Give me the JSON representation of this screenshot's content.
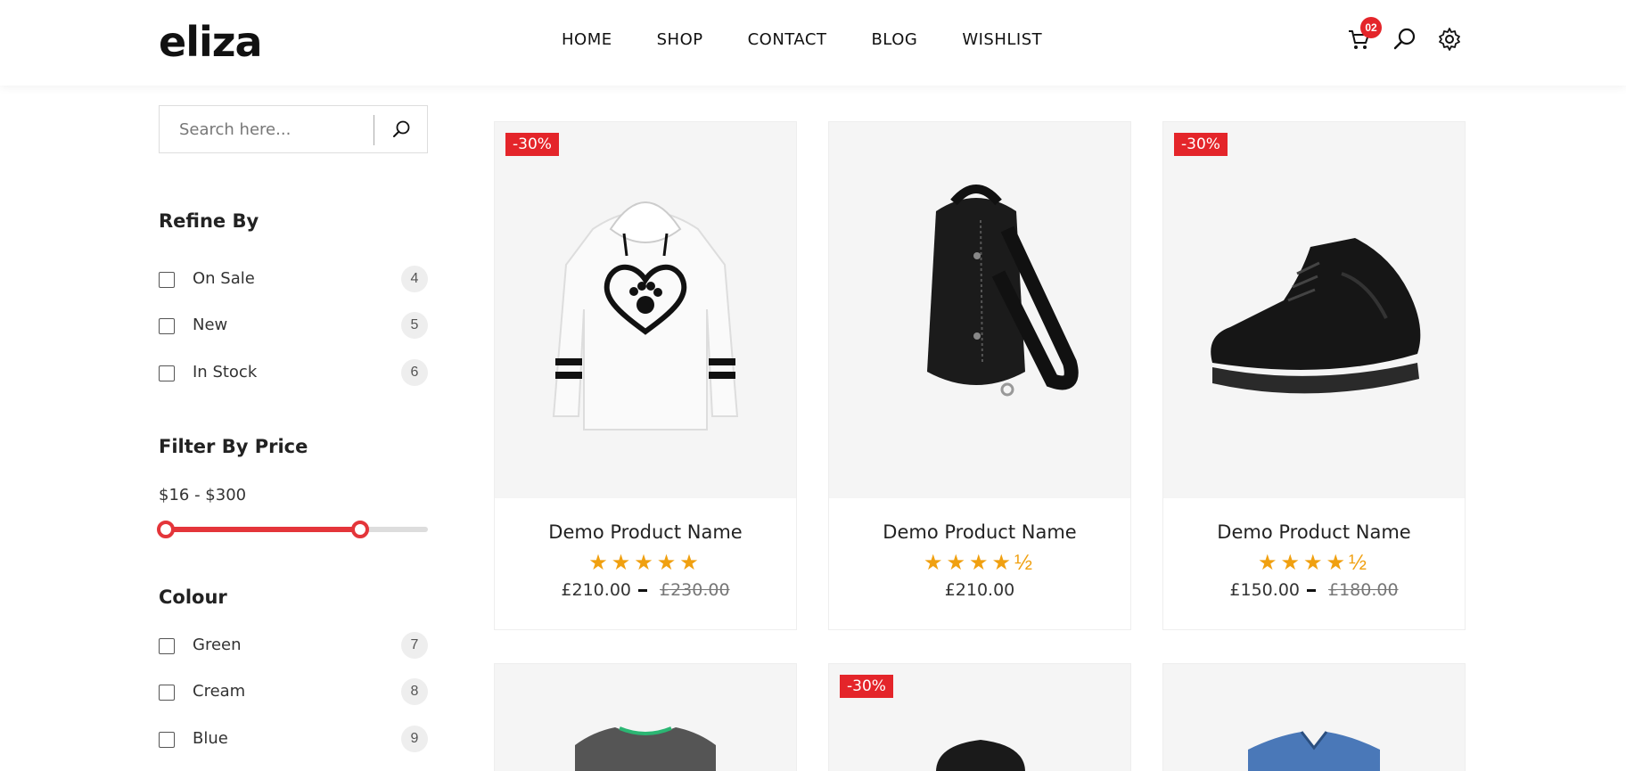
{
  "header": {
    "logo": "eliza",
    "nav": [
      "HOME",
      "SHOP",
      "CONTACT",
      "BLOG",
      "WISHLIST"
    ],
    "cart_count": "02",
    "icons": [
      "cart-icon",
      "search-icon",
      "gear-icon"
    ]
  },
  "sidebar": {
    "search_placeholder": "Search here...",
    "refine_title": "Refine By",
    "refine": [
      {
        "label": "On Sale",
        "count": "4"
      },
      {
        "label": "New",
        "count": "5"
      },
      {
        "label": "In Stock",
        "count": "6"
      }
    ],
    "price_title": "Filter By Price",
    "price_range": "$16 - $300",
    "price_slider": {
      "min_value": 16,
      "max_value": 300,
      "low_fraction": 0,
      "high_fraction": 0.74
    },
    "colour_title": "Colour",
    "colours": [
      {
        "label": "Green",
        "count": "7"
      },
      {
        "label": "Cream",
        "count": "8"
      },
      {
        "label": "Blue",
        "count": "9"
      }
    ]
  },
  "products": [
    {
      "name": "Demo Product Name",
      "badge": "-30%",
      "rating": "★★★★★",
      "price": "£210.00",
      "old_price": "£230.00",
      "image": "hoodie"
    },
    {
      "name": "Demo Product Name",
      "badge": "",
      "rating": "★★★★½",
      "price": "£210.00",
      "old_price": "",
      "image": "backpack"
    },
    {
      "name": "Demo Product Name",
      "badge": "-30%",
      "rating": "★★★★½",
      "price": "£150.00",
      "old_price": "£180.00",
      "image": "sneaker"
    },
    {
      "name": "",
      "badge": "",
      "image": "tshirt"
    },
    {
      "name": "",
      "badge": "-30%",
      "image": "cap"
    },
    {
      "name": "",
      "badge": "",
      "image": "shirt"
    }
  ],
  "colors": {
    "accent": "#e4252a",
    "star": "#f0a010"
  }
}
